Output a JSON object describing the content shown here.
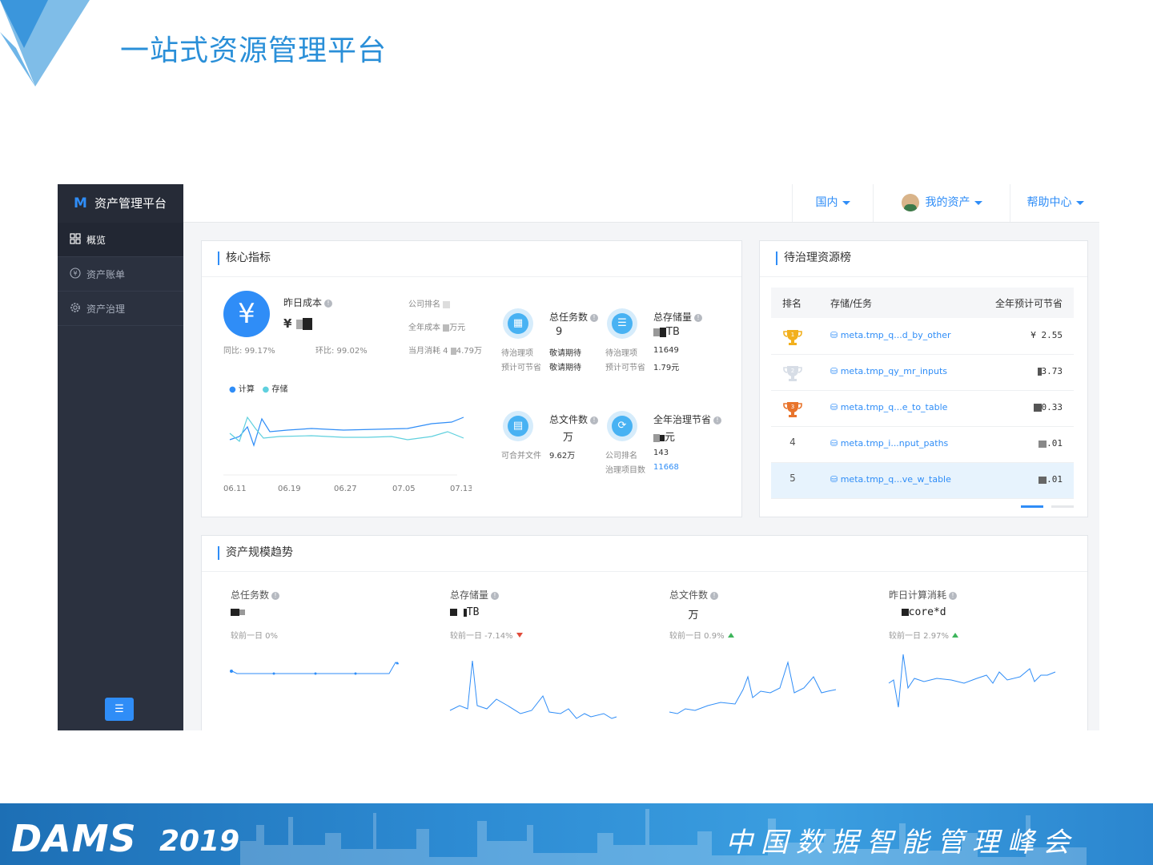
{
  "slide": {
    "title": "一站式资源管理平台",
    "footer_brand": "DAMS",
    "footer_year": "2019",
    "footer_slogan": "中国数据智能管理峰会"
  },
  "sidebar": {
    "app_name": "资产管理平台",
    "items": [
      {
        "label": "概览",
        "icon": "grid-icon",
        "active": true
      },
      {
        "label": "资产账单",
        "icon": "yen-circle-icon",
        "active": false
      },
      {
        "label": "资产治理",
        "icon": "gear-icon",
        "active": false
      }
    ],
    "collapse_icon": "menu-collapse-icon"
  },
  "topbar": {
    "region": "国内",
    "my_assets": "我的资产",
    "help": "帮助中心"
  },
  "core": {
    "title": "核心指标",
    "yesterday_cost_label": "昨日成本",
    "yesterday_cost_prefix": "¥",
    "yoy": "同比: 99.17%",
    "mom": "环比: 99.02%",
    "company_rank_label": "公司排名",
    "year_cost_label": "全年成本 ",
    "year_cost_unit": "万元",
    "month_cost_label": "当月消耗 4",
    "month_cost_value": "4.79万",
    "legend_compute": "计算",
    "legend_storage": "存储",
    "x_ticks": [
      "06.11",
      "06.19",
      "06.27",
      "07.05",
      "07.13"
    ],
    "total_tasks_label": "总任务数",
    "total_tasks_value": "9",
    "pending_label": "待治理项",
    "pending_value": "敬请期待",
    "saving_label": "预计可节省",
    "saving_value": "敬请期待",
    "total_storage_label": "总存储量",
    "total_storage_unit": "TB",
    "storage_pending_label": "待治理项",
    "storage_pending_value": "11649",
    "storage_saving_label": "预计可节省",
    "storage_saving_value": "1.79元",
    "total_files_label": "总文件数",
    "total_files_unit": "万",
    "mergeable_label": "可合并文件",
    "mergeable_value": "9.62万",
    "annual_saving_label": "全年治理节省",
    "annual_saving_unit": "元",
    "company_rank2_label": "公司排名",
    "company_rank2_value": "143",
    "gov_items_label": "治理项目数",
    "gov_items_value": "11668"
  },
  "ranking": {
    "title": "待治理资源榜",
    "col_rank": "排名",
    "col_task": "存储/任务",
    "col_saving": "全年预计可节省",
    "rows": [
      {
        "rank": "1",
        "name": "meta.tmp_q...d_by_other",
        "value": "¥  2.55"
      },
      {
        "rank": "2",
        "name": "meta.tmp_qy_mr_inputs",
        "value": "3.73"
      },
      {
        "rank": "3",
        "name": "meta.tmp_q...e_to_table",
        "value": "0.33"
      },
      {
        "rank": "4",
        "name": "meta.tmp_i...nput_paths",
        "value": ".01"
      },
      {
        "rank": "5",
        "name": "meta.tmp_q...ve_w_table",
        "value": ".01"
      }
    ]
  },
  "trend": {
    "title": "资产规模趋势",
    "cols": [
      {
        "label": "总任务数",
        "value": "",
        "compare": "较前一日 0%",
        "dir": "none"
      },
      {
        "label": "总存储量",
        "value": "TB",
        "compare": "较前一日 -7.14%",
        "dir": "down"
      },
      {
        "label": "总文件数",
        "value": "万",
        "compare": "较前一日 0.9%",
        "dir": "up"
      },
      {
        "label": "昨日计算消耗",
        "value": "core*d",
        "compare": "较前一日 2.97%",
        "dir": "up"
      }
    ]
  },
  "colors": {
    "accent": "#2f8df7",
    "sidebar": "#2b313f",
    "slide_title": "#2a8fd8",
    "compute_line": "#2f8df7",
    "storage_line": "#5fd0de"
  }
}
